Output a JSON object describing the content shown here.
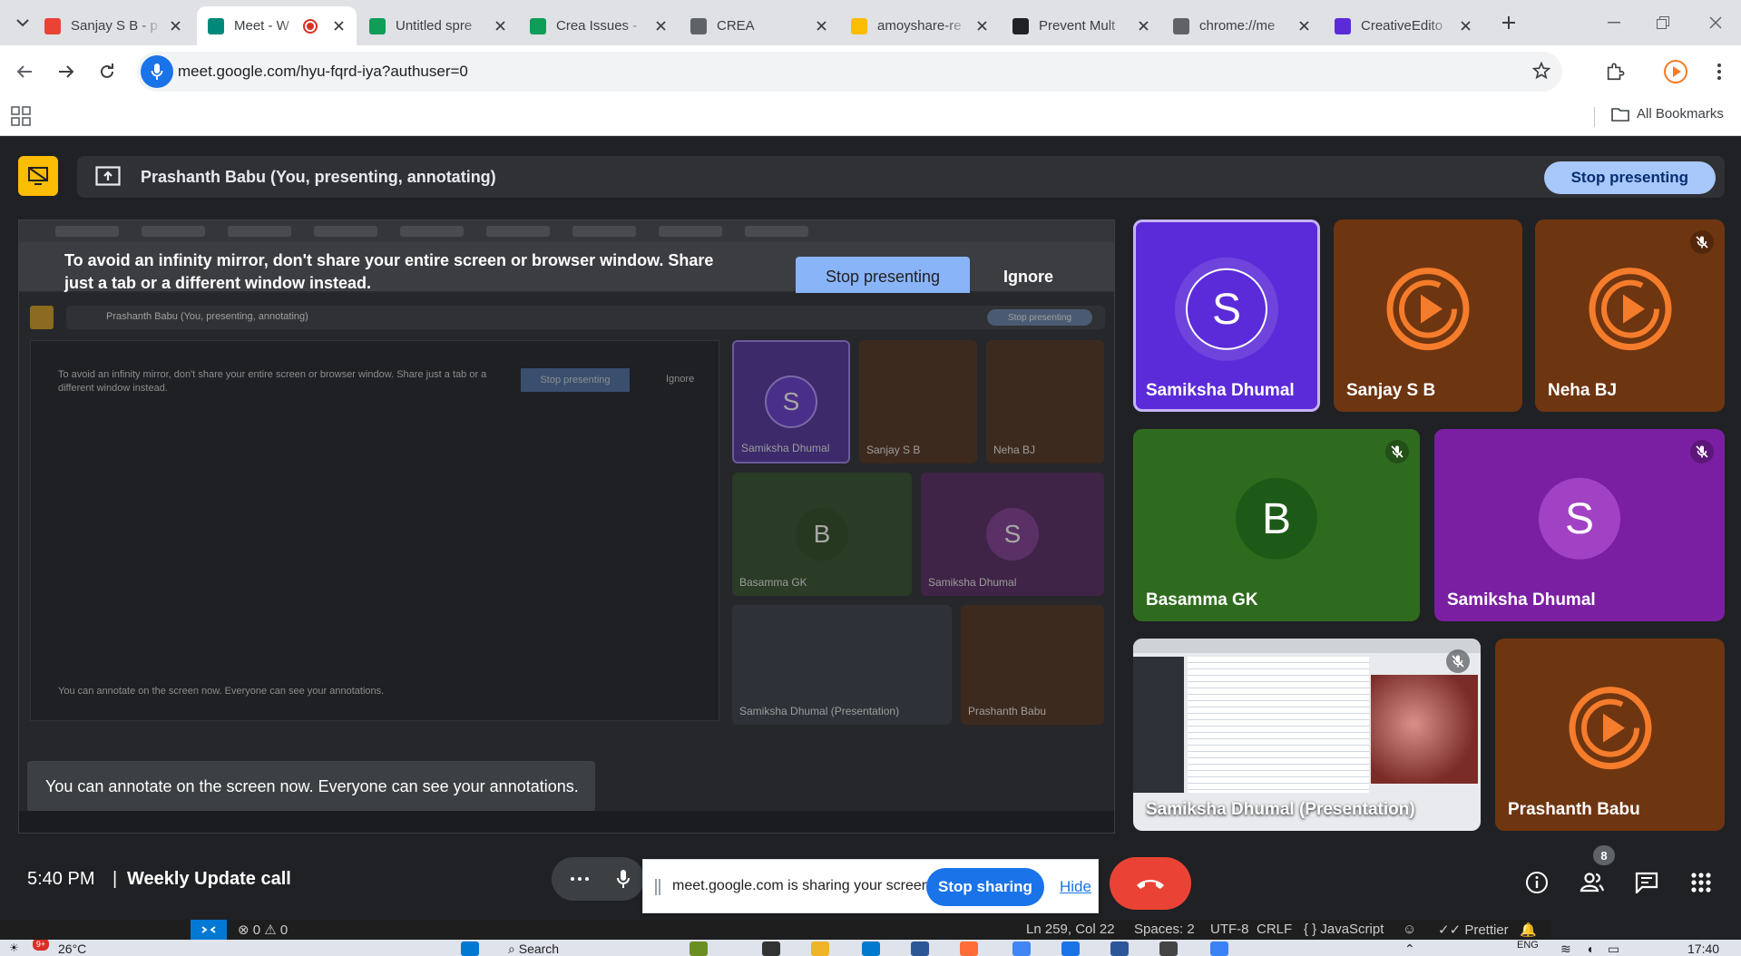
{
  "browser": {
    "tabs": [
      {
        "label": "Sanjay S B - p",
        "favicon": "gmail-icon",
        "color": "#ea4335"
      },
      {
        "label": "Meet - W",
        "favicon": "meet-icon",
        "color": "#00897b",
        "recording": true
      },
      {
        "label": "Untitled spre",
        "favicon": "sheets-icon",
        "color": "#0f9d58"
      },
      {
        "label": "Crea Issues -",
        "favicon": "sheets-icon",
        "color": "#0f9d58"
      },
      {
        "label": "CREA",
        "favicon": "globe-icon",
        "color": "#5f6368"
      },
      {
        "label": "amoyshare-re",
        "favicon": "drive-icon",
        "color": "#fbbc04"
      },
      {
        "label": "Prevent Mult",
        "favicon": "openai-icon",
        "color": "#202124"
      },
      {
        "label": "chrome://me",
        "favicon": "globe-icon",
        "color": "#5f6368"
      },
      {
        "label": "CreativeEdito",
        "favicon": "circle-icon",
        "color": "#5b2bd9"
      }
    ],
    "url": "meet.google.com/hyu-fqrd-iya?authuser=0",
    "bookmarks_folder": "All Bookmarks"
  },
  "meet": {
    "presenting_label": "Prashanth Babu (You, presenting, annotating)",
    "stop_presenting_label": "Stop presenting",
    "infinity_warning": "To avoid an infinity mirror, don't share your entire screen or browser window. Share just a tab or a different window instead.",
    "warning_stop_label": "Stop presenting",
    "warning_ignore_label": "Ignore",
    "annotate_toast": "You can annotate on the screen now. Everyone can see your annotations.",
    "nested": {
      "presenting_label": "Prashanth Babu (You, presenting, annotating)",
      "stop_label": "Stop presenting",
      "warning": "To avoid an infinity mirror, don't share your entire screen or browser window. Share just a tab or a different window instead.",
      "warning_stop": "Stop presenting",
      "warning_ignore": "Ignore",
      "annotate": "You can annotate on the screen now. Everyone can see your annotations.",
      "participants": [
        {
          "name": "Samiksha Dhumal",
          "initial": "S"
        },
        {
          "name": "Sanjay S B",
          "initial": ""
        },
        {
          "name": "Neha BJ",
          "initial": ""
        },
        {
          "name": "Basamma GK",
          "initial": "B"
        },
        {
          "name": "Samiksha Dhumal",
          "initial": "S"
        },
        {
          "name": "Samiksha Dhumal (Presentation)",
          "initial": ""
        },
        {
          "name": "Prashanth Babu",
          "initial": ""
        }
      ]
    },
    "participants": [
      {
        "name": "Samiksha Dhumal",
        "initial": "S",
        "bg": "#5b2bd9",
        "avatar_bg": "#5b2bd9",
        "muted": false,
        "speaking": true
      },
      {
        "name": "Sanjay S B",
        "initial": "",
        "bg": "#6e3511",
        "muted": false
      },
      {
        "name": "Neha BJ",
        "initial": "",
        "bg": "#6e3511",
        "muted": true
      },
      {
        "name": "Basamma GK",
        "initial": "B",
        "bg": "#2f6b1f",
        "avatar_bg": "#1e5a17",
        "muted": true
      },
      {
        "name": "Samiksha Dhumal",
        "initial": "S",
        "bg": "#7b1fa2",
        "avatar_bg": "#a142c4",
        "muted": true
      },
      {
        "name": "Samiksha Dhumal (Presentation)",
        "initial": "",
        "bg": "#1f2a36",
        "muted": true
      },
      {
        "name": "Prashanth Babu",
        "initial": "",
        "bg": "#6e3511",
        "muted": false
      }
    ],
    "time": "5:40 PM",
    "separator": "|",
    "meeting_title": "Weekly Update call",
    "share_notice": "meet.google.com is sharing your screen.",
    "stop_sharing_label": "Stop sharing",
    "hide_label": "Hide",
    "participant_count": "8"
  },
  "vscode_status": {
    "errors": "0",
    "warnings": "0",
    "position": "Ln 259, Col 22",
    "spaces": "Spaces: 2",
    "encoding": "UTF-8",
    "eol": "CRLF",
    "language": "JavaScript",
    "formatter": "Prettier"
  },
  "taskbar": {
    "weather_badge": "9+",
    "temperature": "26°C",
    "search_placeholder": "Search",
    "language": "ENG",
    "clock": "17:40"
  }
}
